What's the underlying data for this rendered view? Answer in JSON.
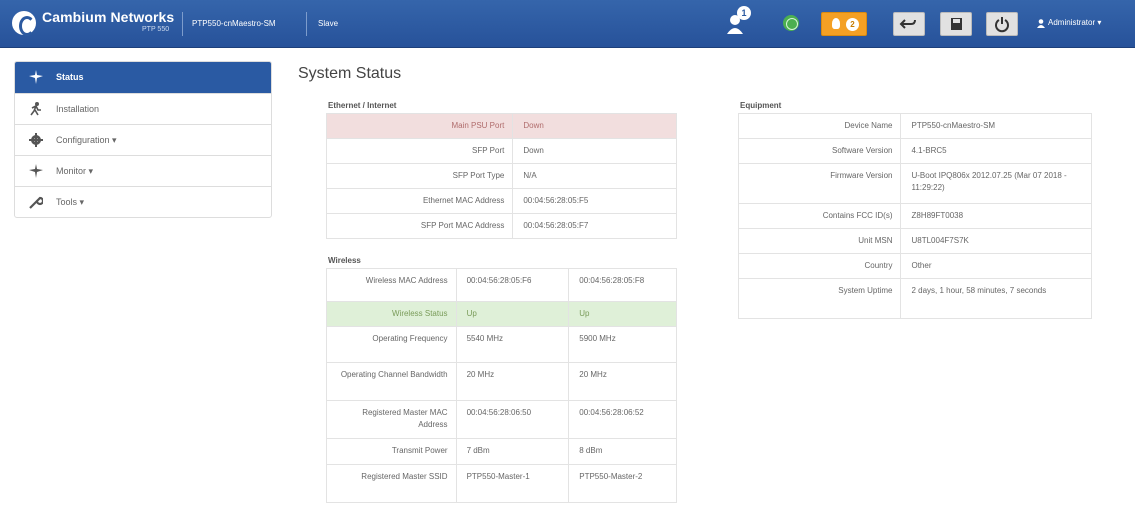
{
  "header": {
    "brand": "Cambium Networks",
    "brand_sub": "PTP 550",
    "device_name": "PTP550-cnMaestro-SM",
    "mode": "Slave",
    "alarm_count": "1",
    "notification_count": "2",
    "user": "Administrator"
  },
  "sidebar": {
    "items": [
      {
        "label": "Status",
        "icon": "status-icon"
      },
      {
        "label": "Installation",
        "icon": "installation-icon"
      },
      {
        "label": "Configuration",
        "icon": "gear-icon"
      },
      {
        "label": "Monitor",
        "icon": "monitor-icon"
      },
      {
        "label": "Tools",
        "icon": "wrench-icon"
      }
    ]
  },
  "page_title": "System Status",
  "ethernet": {
    "title": "Ethernet / Internet",
    "rows": [
      {
        "key": "Main PSU Port",
        "value": "Down"
      },
      {
        "key": "SFP Port",
        "value": "Down"
      },
      {
        "key": "SFP Port Type",
        "value": "N/A"
      },
      {
        "key": "Ethernet MAC Address",
        "value": "00:04:56:28:05:F5"
      },
      {
        "key": "SFP Port MAC Address",
        "value": "00:04:56:28:05:F7"
      }
    ]
  },
  "wireless": {
    "title": "Wireless",
    "rows": [
      {
        "key": "Wireless MAC Address",
        "v1": "00:04:56:28:05:F6",
        "v2": "00:04:56:28:05:F8"
      },
      {
        "key": "Wireless Status",
        "v1": "Up",
        "v2": "Up"
      },
      {
        "key": "Operating Frequency",
        "v1": "5540 MHz",
        "v2": "5900 MHz"
      },
      {
        "key": "Operating Channel Bandwidth",
        "v1": "20 MHz",
        "v2": "20 MHz"
      },
      {
        "key": "Registered Master MAC Address",
        "v1": "00:04:56:28:06:50",
        "v2": "00:04:56:28:06:52"
      },
      {
        "key": "Transmit Power",
        "v1": "7 dBm",
        "v2": "8 dBm"
      },
      {
        "key": "Registered Master SSID",
        "v1": "PTP550-Master-1",
        "v2": "PTP550-Master-2"
      }
    ]
  },
  "equipment": {
    "title": "Equipment",
    "rows": [
      {
        "key": "Device Name",
        "value": "PTP550-cnMaestro-SM"
      },
      {
        "key": "Software Version",
        "value": "4.1-BRC5"
      },
      {
        "key": "Firmware Version",
        "value": "U-Boot IPQ806x 2012.07.25 (Mar 07 2018 - 11:29:22)"
      },
      {
        "key": "Contains FCC ID(s)",
        "value": "Z8H89FT0038"
      },
      {
        "key": "Unit MSN",
        "value": "U8TL004F7S7K"
      },
      {
        "key": "Country",
        "value": "Other"
      },
      {
        "key": "System Uptime",
        "value": "2 days, 1 hour, 58 minutes, 7 seconds"
      }
    ]
  },
  "colors": {
    "header_bg": "#2c5aa0",
    "active_nav": "#2a5aa3",
    "down_row_bg": "#f2dede",
    "up_row_bg": "#dff0d8",
    "notification_orange": "#f4a024"
  }
}
